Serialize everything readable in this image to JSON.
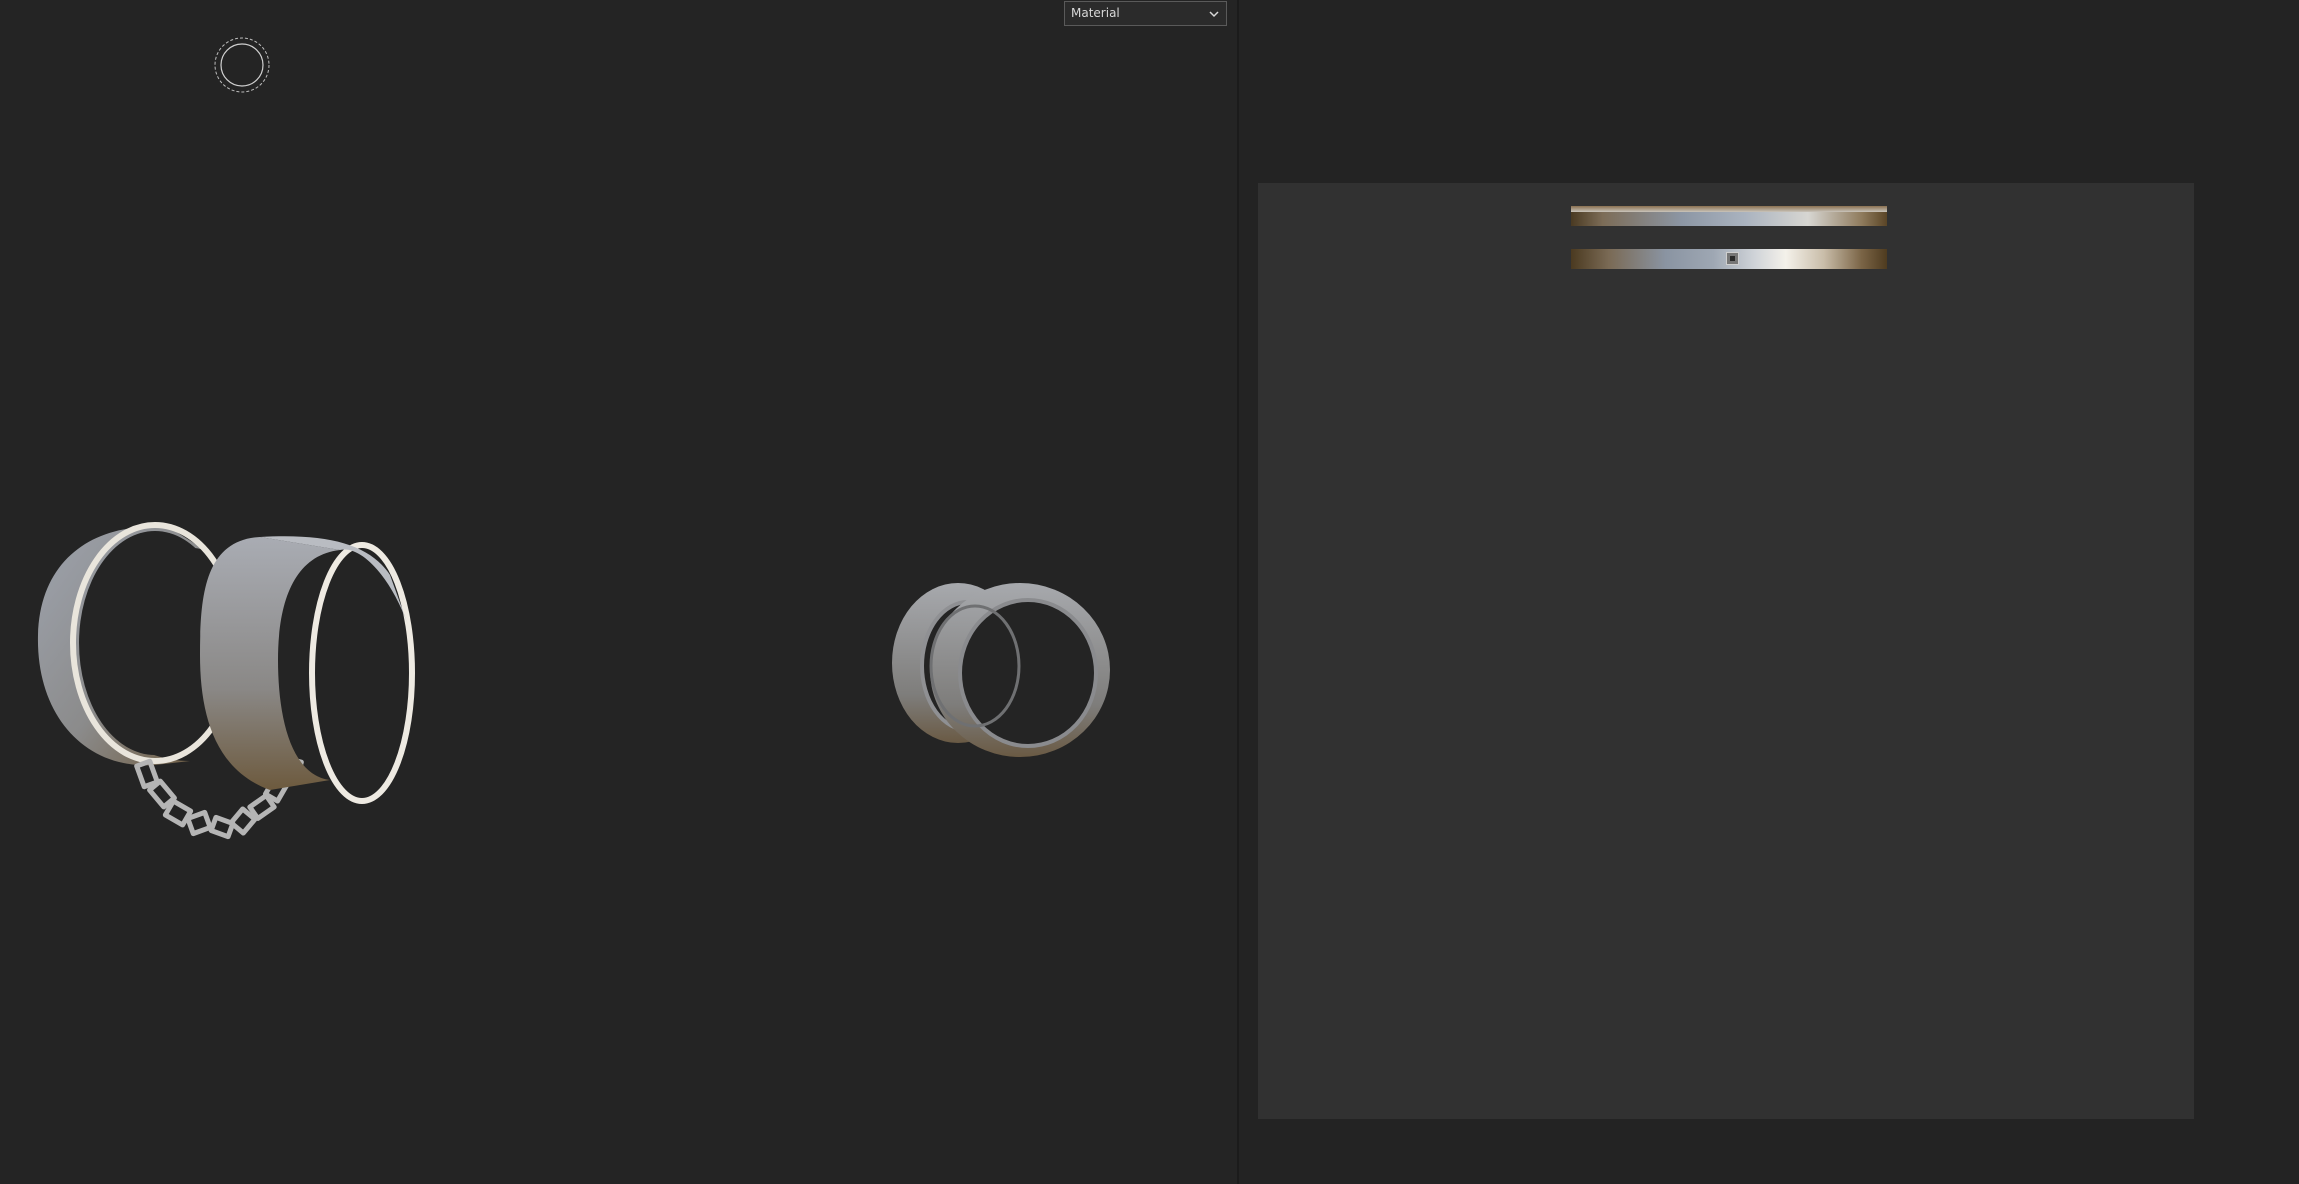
{
  "viewport": {
    "shading_dropdown": {
      "selected": "Material",
      "icon": "chevron-down-icon"
    },
    "gizmo_icon": "orbit-gizmo-icon",
    "models": [
      {
        "name": "shackles-with-chain"
      },
      {
        "name": "rings-pair"
      }
    ]
  },
  "uv_editor": {
    "strips": [
      "uv-island-top",
      "uv-island-bottom"
    ],
    "colors": {
      "canvas": "#313131",
      "panel": "#232323",
      "viewport": "#242424"
    }
  }
}
